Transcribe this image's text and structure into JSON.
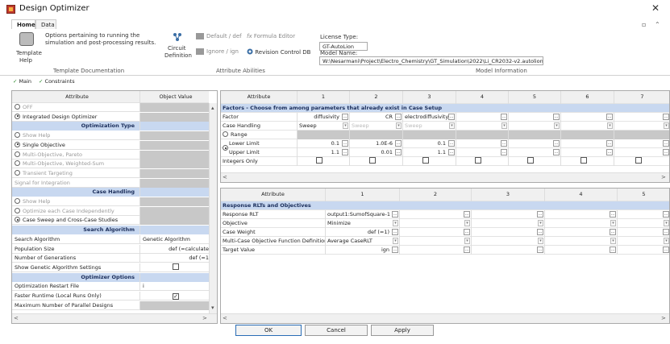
{
  "window": {
    "title": "Design Optimizer",
    "close": "✕"
  },
  "tabs": [
    {
      "label": "Home"
    },
    {
      "label": "Data"
    }
  ],
  "ribbon": {
    "template_help": {
      "line1": "Template",
      "line2": "Help",
      "desc1": "Options pertaining to running the",
      "desc2": "simulation and post-processing results.",
      "group": "Template Documentation"
    },
    "attr": {
      "circuit1": "Circuit",
      "circuit2": "Definition",
      "default_def": "Default / def",
      "formula_editor": "Formula Editor",
      "ignore": "Ignore / ign",
      "revision": "Revision Control DB",
      "group": "Attribute Abilities",
      "fx": "fx"
    },
    "model": {
      "license_label": "License Type:",
      "license_value": "GT-AutoLion",
      "model_label": "Model Name:",
      "model_value": "W:\\Nesarmani\\Project\\Electro_Chemistry\\GT_Simulation\\2022\\Li_CR2032-v2.autolion",
      "group": "Model Information"
    },
    "ctrl": {
      "min": "▫",
      "up": "⌃"
    }
  },
  "subtabs": [
    {
      "label": "Main"
    },
    {
      "label": "Constraints"
    }
  ],
  "left": {
    "head": {
      "attribute": "Attribute",
      "value": "Object Value"
    },
    "rows": [
      {
        "a": "OFF",
        "kind": "radio",
        "on": false,
        "dis": true
      },
      {
        "a": "Integrated Design Optimizer",
        "kind": "radio",
        "on": true
      },
      {
        "a": "Optimization Type",
        "kind": "sec"
      },
      {
        "a": "Show Help",
        "kind": "radio",
        "on": false,
        "dis": true
      },
      {
        "a": "Single Objective",
        "kind": "radio",
        "on": true
      },
      {
        "a": "Multi-Objective, Pareto",
        "kind": "radio",
        "on": false,
        "dis": true
      },
      {
        "a": "Multi-Objective, Weighted-Sum",
        "kind": "radio",
        "on": false,
        "dis": true
      },
      {
        "a": "Transient Targeting",
        "kind": "radio",
        "on": false,
        "dis": true
      },
      {
        "a": "Signal for Integration",
        "kind": "plain",
        "dis": true
      },
      {
        "a": "Case Handling",
        "kind": "sec"
      },
      {
        "a": "Show Help",
        "kind": "radio",
        "on": false,
        "dis": true
      },
      {
        "a": "Optimize each Case Independently",
        "kind": "radio",
        "on": false,
        "dis": true
      },
      {
        "a": "Case Sweep and Cross-Case Studies",
        "kind": "radio",
        "on": true
      },
      {
        "a": "Search Algorithm",
        "kind": "sec"
      },
      {
        "a": "Search Algorithm",
        "kind": "val",
        "v": "Genetic Algorithm"
      },
      {
        "a": "Population Size",
        "kind": "val",
        "v": "def (=calculate"
      },
      {
        "a": "Number of Generations",
        "kind": "val",
        "v": "def (=1"
      },
      {
        "a": "Show Genetic Algorithm Settings",
        "kind": "cb"
      },
      {
        "a": "Optimizer Options",
        "kind": "sec"
      },
      {
        "a": "Optimization Restart File",
        "kind": "val",
        "v": "i"
      },
      {
        "a": "Faster Runtime (Local Runs Only)",
        "kind": "cbon"
      },
      {
        "a": "Maximum Number of Parallel Designs",
        "kind": "plain"
      }
    ]
  },
  "grid1": {
    "head": [
      "Attribute",
      "1",
      "2",
      "3",
      "4",
      "5",
      "6",
      "7"
    ],
    "section": "Factors - Choose from among parameters that already exist in Case Setup",
    "factor": [
      "Factor",
      "diffusivity",
      "CR",
      "electrodiffusivity"
    ],
    "handling": [
      "Case Handling",
      "Sweep",
      "Sweep",
      "Sweep"
    ],
    "range": "Range",
    "lower": [
      "Lower Limit",
      "0.1",
      "1.0E-6",
      "0.1"
    ],
    "upper": [
      "Upper Limit",
      "1.1",
      "0.01",
      "1.1"
    ],
    "integers": "Integers Only"
  },
  "grid2": {
    "head": [
      "Attribute",
      "1",
      "2",
      "3",
      "4",
      "5"
    ],
    "section": "Response RLTs and Objectives",
    "rows": [
      [
        "Response RLT",
        "output1:SumofSquare-1"
      ],
      [
        "Objective",
        "Minimize"
      ],
      [
        "Case Weight",
        "def (=1)"
      ],
      [
        "Multi-Case Objective Function Definition",
        "Average CaseRLT"
      ],
      [
        "Target Value",
        "ign"
      ]
    ]
  },
  "buttons": {
    "ok": "OK",
    "cancel": "Cancel",
    "apply": "Apply"
  },
  "glyphs": {
    "dd": "▾",
    "ell": "...",
    "up": "▴",
    "down": "▾",
    "left": "<",
    "right": ">",
    "check": "✓"
  }
}
